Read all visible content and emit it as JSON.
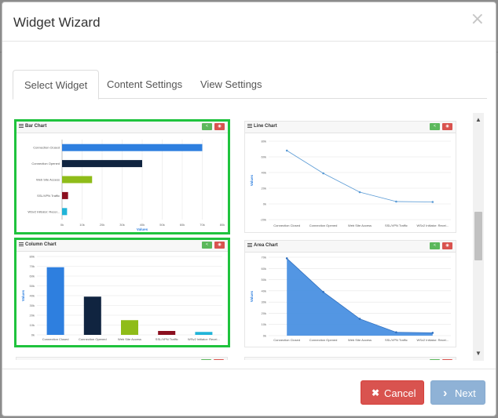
{
  "modal": {
    "title": "Widget Wizard",
    "close_glyph": "×"
  },
  "tabs": [
    {
      "label": "Select Widget",
      "active": true
    },
    {
      "label": "Content Settings",
      "active": false
    },
    {
      "label": "View Settings",
      "active": false
    }
  ],
  "scrollbar": {
    "up_glyph": "▲",
    "down_glyph": "▼"
  },
  "colors": {
    "selected_border": "#1fc33d",
    "cancel": "#d9534f",
    "next": "#8fb2d6",
    "line": "#5b9bd5",
    "area": "#4a90e2"
  },
  "widget_buttons": {
    "share_glyph": "<",
    "delete_glyph": "◉"
  },
  "widgets": [
    {
      "id": "bar",
      "title": "Bar Chart",
      "selected": true
    },
    {
      "id": "line",
      "title": "Line Chart",
      "selected": false
    },
    {
      "id": "column",
      "title": "Column Chart",
      "selected": true
    },
    {
      "id": "area",
      "title": "Area Chart",
      "selected": false
    }
  ],
  "chart_data": [
    {
      "type": "bar",
      "title": "Bar Chart",
      "categories": [
        "Connection Closed",
        "Connection Opened",
        "Web Site Access",
        "SSL/VPN Traffic",
        "WSv2 Initiator: Recei..."
      ],
      "values": [
        70,
        40,
        15,
        3,
        2.5
      ],
      "bar_colors": [
        "#2e7fdf",
        "#102440",
        "#8fbc19",
        "#8b0f1f",
        "#21b4d8"
      ],
      "xticks": [
        "0k",
        "10k",
        "20k",
        "30k",
        "40k",
        "50k",
        "60k",
        "70k",
        "80k"
      ],
      "xlim": [
        0,
        80
      ],
      "xlabel": "Values",
      "grid": true
    },
    {
      "type": "line",
      "title": "Line Chart",
      "categories": [
        "Connection Closed",
        "Connection Opened",
        "Web Site Access",
        "SSL/VPN Traffic",
        "WSv2 Initiator: Recei..."
      ],
      "values": [
        68,
        39,
        15,
        3,
        2.5
      ],
      "yticks": [
        "-20k",
        "0k",
        "20k",
        "40k",
        "60k",
        "80k"
      ],
      "ylim": [
        -20,
        80
      ],
      "ylabel": "Values",
      "grid": true
    },
    {
      "type": "bar",
      "title": "Column Chart",
      "categories": [
        "Connection Closed",
        "Connection Opened",
        "Web Site Access",
        "SSL/VPN Traffic",
        "WSv2 Initiator: Recei..."
      ],
      "values": [
        69,
        39,
        15,
        4,
        3
      ],
      "bar_colors": [
        "#2e7fdf",
        "#102440",
        "#8fbc19",
        "#8b0f1f",
        "#21b4d8"
      ],
      "yticks": [
        "0k",
        "10k",
        "20k",
        "30k",
        "40k",
        "50k",
        "60k",
        "70k",
        "80k"
      ],
      "ylim": [
        0,
        80
      ],
      "ylabel": "Values",
      "grid": true
    },
    {
      "type": "area",
      "title": "Area Chart",
      "categories": [
        "Connection Closed",
        "Connection Opened",
        "Web Site Access",
        "SSL/VPN Traffic",
        "WSv2 Initiator: Recei..."
      ],
      "values": [
        69,
        39,
        15,
        3,
        2.5
      ],
      "yticks": [
        "0k",
        "10k",
        "20k",
        "30k",
        "40k",
        "50k",
        "60k",
        "70k"
      ],
      "ylim": [
        0,
        70
      ],
      "ylabel": "Values",
      "grid": true
    }
  ],
  "footer": {
    "cancel_label": "Cancel",
    "cancel_glyph": "✖",
    "next_label": "Next",
    "next_glyph": "›"
  }
}
